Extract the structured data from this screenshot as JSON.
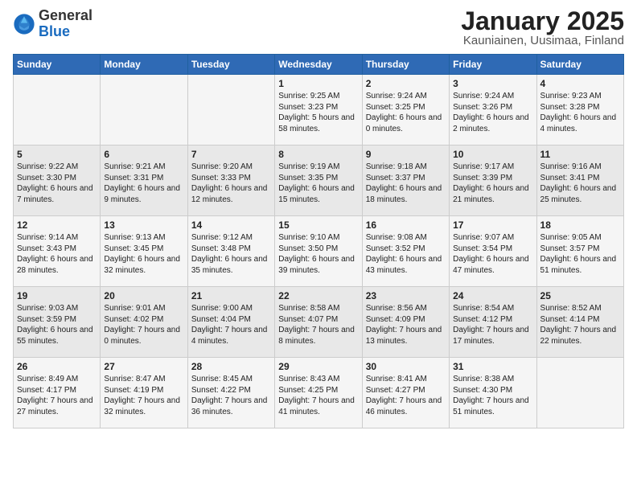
{
  "header": {
    "logo_line1": "General",
    "logo_line2": "Blue",
    "title": "January 2025",
    "subtitle": "Kauniainen, Uusimaa, Finland"
  },
  "days_of_week": [
    "Sunday",
    "Monday",
    "Tuesday",
    "Wednesday",
    "Thursday",
    "Friday",
    "Saturday"
  ],
  "weeks": [
    [
      {
        "day": "",
        "info": ""
      },
      {
        "day": "",
        "info": ""
      },
      {
        "day": "",
        "info": ""
      },
      {
        "day": "1",
        "info": "Sunrise: 9:25 AM\nSunset: 3:23 PM\nDaylight: 5 hours and 58 minutes."
      },
      {
        "day": "2",
        "info": "Sunrise: 9:24 AM\nSunset: 3:25 PM\nDaylight: 6 hours and 0 minutes."
      },
      {
        "day": "3",
        "info": "Sunrise: 9:24 AM\nSunset: 3:26 PM\nDaylight: 6 hours and 2 minutes."
      },
      {
        "day": "4",
        "info": "Sunrise: 9:23 AM\nSunset: 3:28 PM\nDaylight: 6 hours and 4 minutes."
      }
    ],
    [
      {
        "day": "5",
        "info": "Sunrise: 9:22 AM\nSunset: 3:30 PM\nDaylight: 6 hours and 7 minutes."
      },
      {
        "day": "6",
        "info": "Sunrise: 9:21 AM\nSunset: 3:31 PM\nDaylight: 6 hours and 9 minutes."
      },
      {
        "day": "7",
        "info": "Sunrise: 9:20 AM\nSunset: 3:33 PM\nDaylight: 6 hours and 12 minutes."
      },
      {
        "day": "8",
        "info": "Sunrise: 9:19 AM\nSunset: 3:35 PM\nDaylight: 6 hours and 15 minutes."
      },
      {
        "day": "9",
        "info": "Sunrise: 9:18 AM\nSunset: 3:37 PM\nDaylight: 6 hours and 18 minutes."
      },
      {
        "day": "10",
        "info": "Sunrise: 9:17 AM\nSunset: 3:39 PM\nDaylight: 6 hours and 21 minutes."
      },
      {
        "day": "11",
        "info": "Sunrise: 9:16 AM\nSunset: 3:41 PM\nDaylight: 6 hours and 25 minutes."
      }
    ],
    [
      {
        "day": "12",
        "info": "Sunrise: 9:14 AM\nSunset: 3:43 PM\nDaylight: 6 hours and 28 minutes."
      },
      {
        "day": "13",
        "info": "Sunrise: 9:13 AM\nSunset: 3:45 PM\nDaylight: 6 hours and 32 minutes."
      },
      {
        "day": "14",
        "info": "Sunrise: 9:12 AM\nSunset: 3:48 PM\nDaylight: 6 hours and 35 minutes."
      },
      {
        "day": "15",
        "info": "Sunrise: 9:10 AM\nSunset: 3:50 PM\nDaylight: 6 hours and 39 minutes."
      },
      {
        "day": "16",
        "info": "Sunrise: 9:08 AM\nSunset: 3:52 PM\nDaylight: 6 hours and 43 minutes."
      },
      {
        "day": "17",
        "info": "Sunrise: 9:07 AM\nSunset: 3:54 PM\nDaylight: 6 hours and 47 minutes."
      },
      {
        "day": "18",
        "info": "Sunrise: 9:05 AM\nSunset: 3:57 PM\nDaylight: 6 hours and 51 minutes."
      }
    ],
    [
      {
        "day": "19",
        "info": "Sunrise: 9:03 AM\nSunset: 3:59 PM\nDaylight: 6 hours and 55 minutes."
      },
      {
        "day": "20",
        "info": "Sunrise: 9:01 AM\nSunset: 4:02 PM\nDaylight: 7 hours and 0 minutes."
      },
      {
        "day": "21",
        "info": "Sunrise: 9:00 AM\nSunset: 4:04 PM\nDaylight: 7 hours and 4 minutes."
      },
      {
        "day": "22",
        "info": "Sunrise: 8:58 AM\nSunset: 4:07 PM\nDaylight: 7 hours and 8 minutes."
      },
      {
        "day": "23",
        "info": "Sunrise: 8:56 AM\nSunset: 4:09 PM\nDaylight: 7 hours and 13 minutes."
      },
      {
        "day": "24",
        "info": "Sunrise: 8:54 AM\nSunset: 4:12 PM\nDaylight: 7 hours and 17 minutes."
      },
      {
        "day": "25",
        "info": "Sunrise: 8:52 AM\nSunset: 4:14 PM\nDaylight: 7 hours and 22 minutes."
      }
    ],
    [
      {
        "day": "26",
        "info": "Sunrise: 8:49 AM\nSunset: 4:17 PM\nDaylight: 7 hours and 27 minutes."
      },
      {
        "day": "27",
        "info": "Sunrise: 8:47 AM\nSunset: 4:19 PM\nDaylight: 7 hours and 32 minutes."
      },
      {
        "day": "28",
        "info": "Sunrise: 8:45 AM\nSunset: 4:22 PM\nDaylight: 7 hours and 36 minutes."
      },
      {
        "day": "29",
        "info": "Sunrise: 8:43 AM\nSunset: 4:25 PM\nDaylight: 7 hours and 41 minutes."
      },
      {
        "day": "30",
        "info": "Sunrise: 8:41 AM\nSunset: 4:27 PM\nDaylight: 7 hours and 46 minutes."
      },
      {
        "day": "31",
        "info": "Sunrise: 8:38 AM\nSunset: 4:30 PM\nDaylight: 7 hours and 51 minutes."
      },
      {
        "day": "",
        "info": ""
      }
    ]
  ]
}
